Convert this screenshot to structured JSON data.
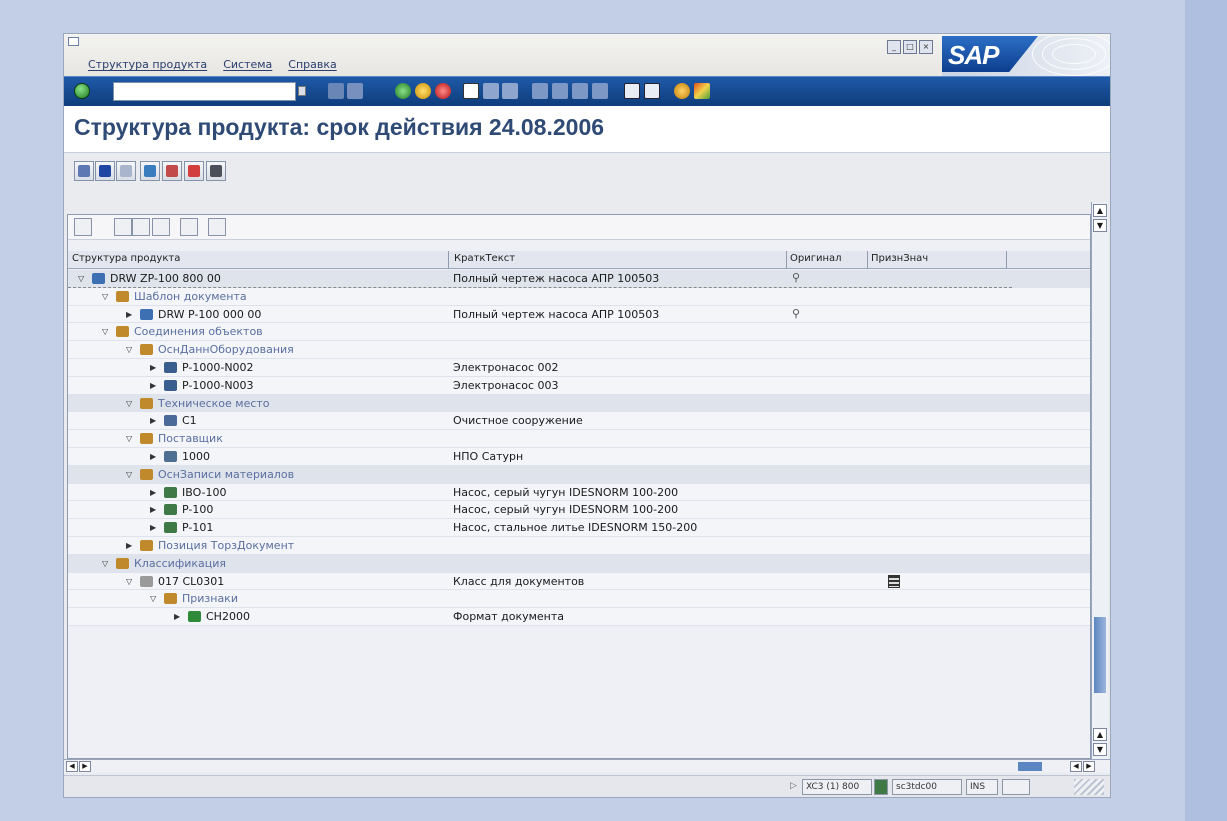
{
  "menu": {
    "items": [
      "Структура продукта",
      "Система",
      "Справка"
    ]
  },
  "logo_text": "SAP",
  "page_title": "Структура продукта: срок действия 24.08.2006",
  "columns": [
    "Структура продукта",
    "КраткТекст",
    "Оригинал",
    "ПризнЗнач"
  ],
  "tree": [
    {
      "name": "DRW ZP-100 800 00",
      "desc": "Полный чертеж насоса АПР 100503",
      "icon": "document-icon",
      "orig": "link-icon"
    },
    {
      "name": "Шаблон документа",
      "desc": "",
      "icon": "folder-link-icon"
    },
    {
      "name": "DRW P-100 000 00",
      "desc": "Полный чертеж насоса АПР 100503",
      "icon": "document-icon",
      "orig": "link-icon"
    },
    {
      "name": "Соединения объектов",
      "desc": "",
      "icon": "folder-link-icon"
    },
    {
      "name": "ОснДаннОборудования",
      "desc": "",
      "icon": "folder-link-icon"
    },
    {
      "name": "P-1000-N002",
      "desc": "Электронасос 002",
      "icon": "equipment-icon"
    },
    {
      "name": "P-1000-N003",
      "desc": "Электронасос 003",
      "icon": "equipment-icon"
    },
    {
      "name": "Техническое место",
      "desc": "",
      "icon": "folder-link-icon"
    },
    {
      "name": "C1",
      "desc": "Очистное сооружение",
      "icon": "functional-location-icon"
    },
    {
      "name": "Поставщик",
      "desc": "",
      "icon": "folder-link-icon"
    },
    {
      "name": "1000",
      "desc": "НПО Сатурн",
      "icon": "vendor-truck-icon"
    },
    {
      "name": "ОснЗаписи материалов",
      "desc": "",
      "icon": "folder-link-icon"
    },
    {
      "name": "IBO-100",
      "desc": "Насос, серый чугун IDESNORM 100-200",
      "icon": "material-icon"
    },
    {
      "name": "P-100",
      "desc": "Насос, серый чугун IDESNORM 100-200",
      "icon": "material-icon"
    },
    {
      "name": "P-101",
      "desc": "Насос, стальное литье IDESNORM 150-200",
      "icon": "material-icon"
    },
    {
      "name": "Позиция ТорзДокумент",
      "desc": "",
      "icon": "folder-link-icon"
    },
    {
      "name": "Классификация",
      "desc": "",
      "icon": "folder-link-icon"
    },
    {
      "name": "017 CL0301",
      "desc": "Класс для документов",
      "icon": "class-icon",
      "value_icon": "film-icon"
    },
    {
      "name": "Признаки",
      "desc": "",
      "icon": "folder-link-icon"
    },
    {
      "name": "CH2000",
      "desc": "Формат документа",
      "icon": "characteristic-icon"
    }
  ],
  "status": {
    "system": "XC3 (1) 800",
    "server": "sc3tdc00",
    "mode": "INS"
  },
  "colors": {
    "page_bg": "#c3cfe6",
    "toolbar": "#0f3d7c",
    "title_text": "#2e4a75",
    "tree_folder": "#5a6fa0"
  }
}
